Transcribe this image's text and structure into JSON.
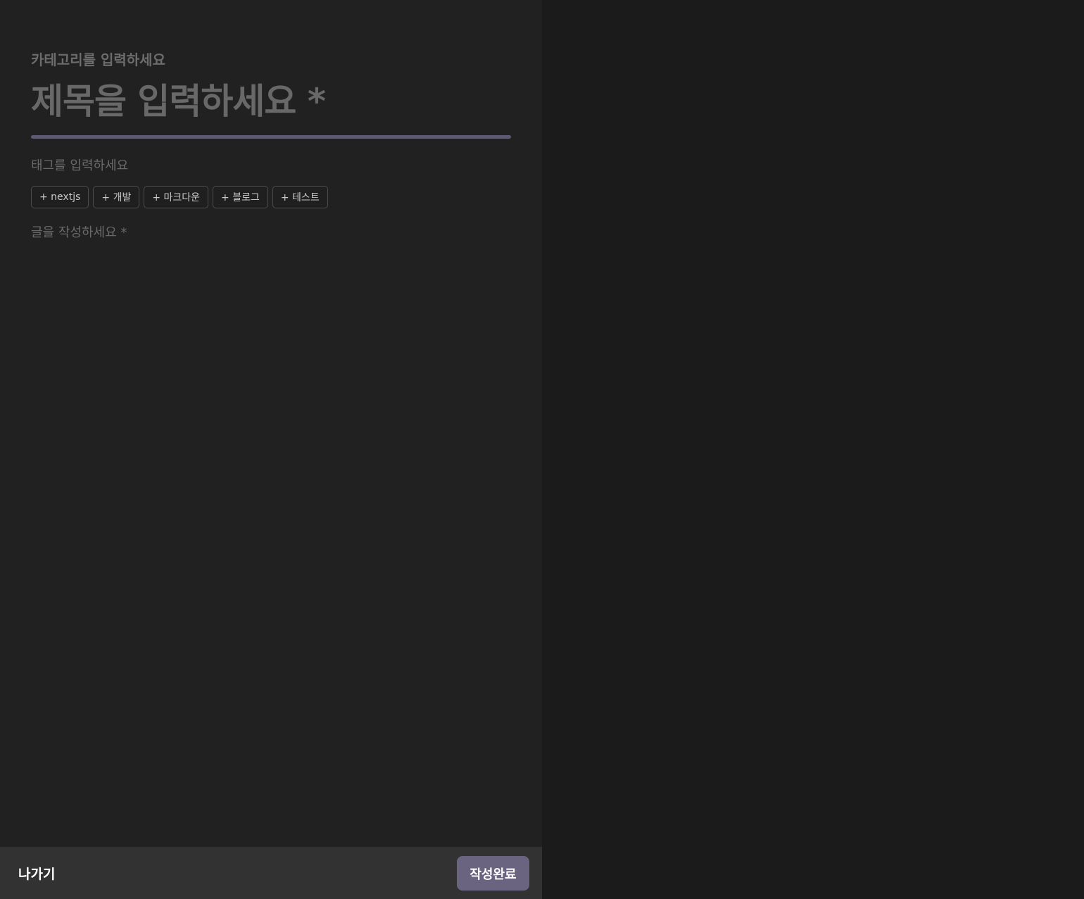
{
  "colors": {
    "accent": "#6b6480",
    "divider": "#5e5a72",
    "editor_bg": "#212121",
    "preview_bg": "#1b1b1b",
    "footer_bg": "#323232"
  },
  "editor": {
    "category_placeholder": "카테고리를 입력하세요",
    "title_placeholder": "제목을 입력하세요 *",
    "tag_placeholder": "태그를 입력하세요",
    "tags": [
      {
        "label": "+ nextjs"
      },
      {
        "label": "+ 개발"
      },
      {
        "label": "+ 마크다운"
      },
      {
        "label": "+ 블로그"
      },
      {
        "label": "+ 테스트"
      }
    ],
    "body_placeholder": "글을 작성하세요 *"
  },
  "footer": {
    "exit_label": "나가기",
    "submit_label": "작성완료"
  }
}
